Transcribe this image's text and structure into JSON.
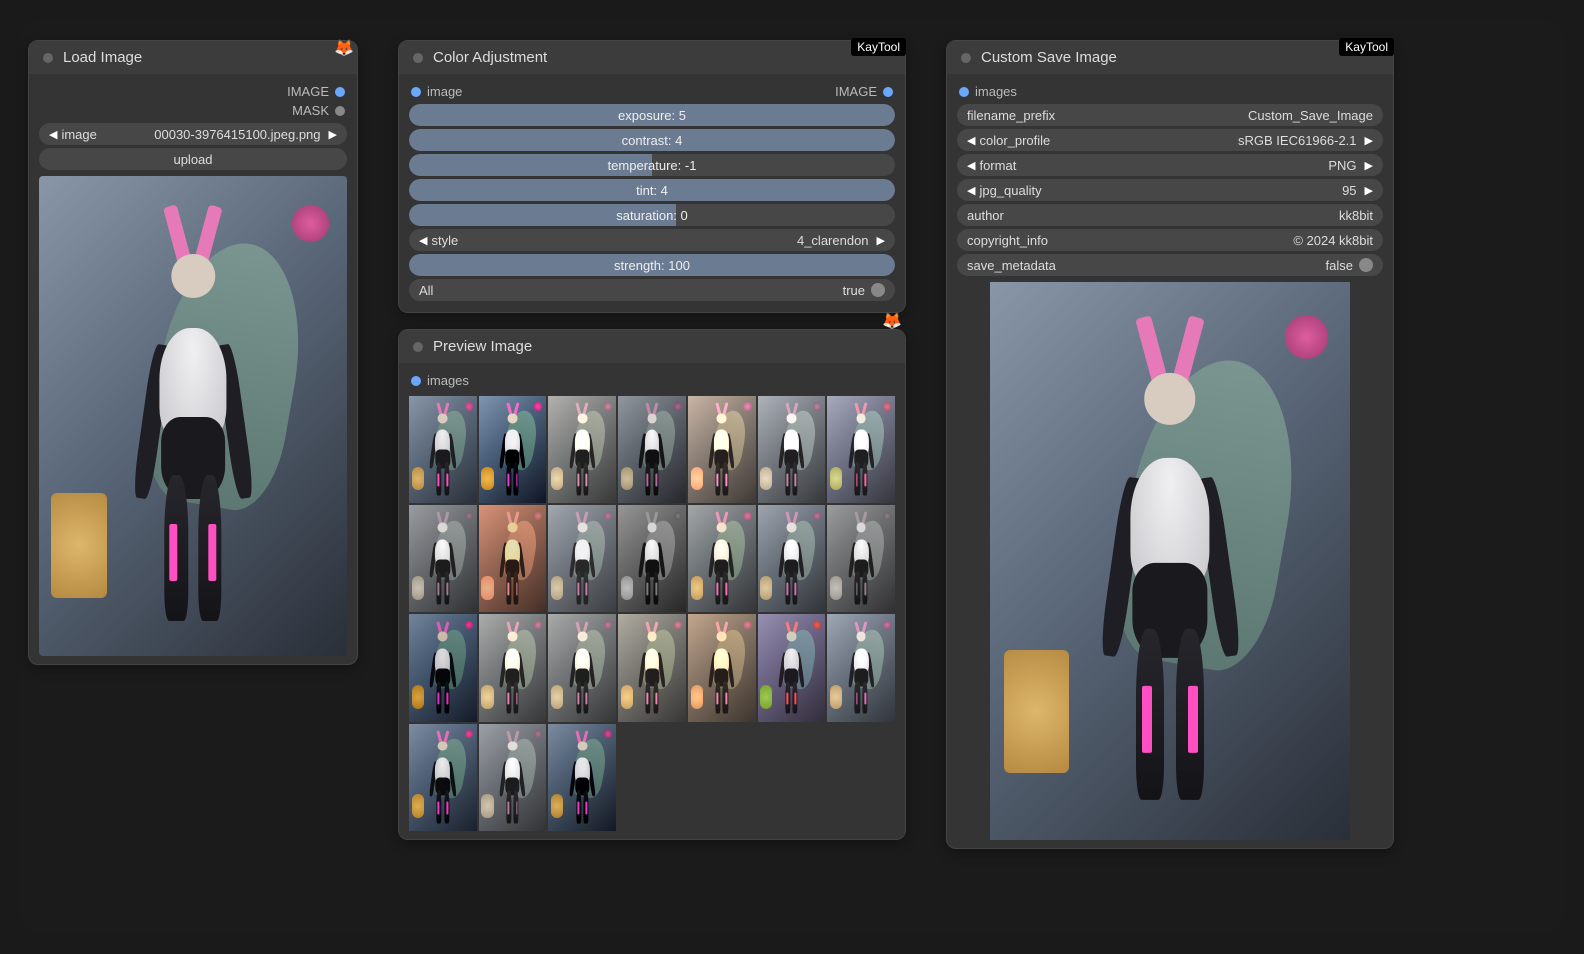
{
  "badges": {
    "kaytool": "KayTool",
    "fox": "🦊"
  },
  "load": {
    "title": "Load Image",
    "out_image": "IMAGE",
    "out_mask": "MASK",
    "image_label": "image",
    "image_value": "00030-3976415100.jpeg.png",
    "upload": "upload"
  },
  "color": {
    "title": "Color Adjustment",
    "in_image": "image",
    "out_image": "IMAGE",
    "sliders": {
      "exposure": {
        "text": "exposure: 5",
        "pct": 100
      },
      "contrast": {
        "text": "contrast: 4",
        "pct": 100
      },
      "temperature": {
        "text": "temperature: -1",
        "pct": 50
      },
      "tint": {
        "text": "tint: 4",
        "pct": 100
      },
      "saturation": {
        "text": "saturation: 0",
        "pct": 55
      },
      "strength": {
        "text": "strength: 100",
        "pct": 100
      }
    },
    "style_label": "style",
    "style_value": "4_clarendon",
    "all_label": "All",
    "all_value": "true"
  },
  "preview": {
    "title": "Preview Image",
    "in_images": "images",
    "count": 24
  },
  "save": {
    "title": "Custom Save Image",
    "in_images": "images",
    "filename_prefix_label": "filename_prefix",
    "filename_prefix_value": "Custom_Save_Image",
    "color_profile_label": "color_profile",
    "color_profile_value": "sRGB IEC61966-2.1",
    "format_label": "format",
    "format_value": "PNG",
    "jpg_quality_label": "jpg_quality",
    "jpg_quality_value": "95",
    "author_label": "author",
    "author_value": "kk8bit",
    "copyright_label": "copyright_info",
    "copyright_value": "© 2024 kk8bit",
    "save_metadata_label": "save_metadata",
    "save_metadata_value": "false"
  }
}
